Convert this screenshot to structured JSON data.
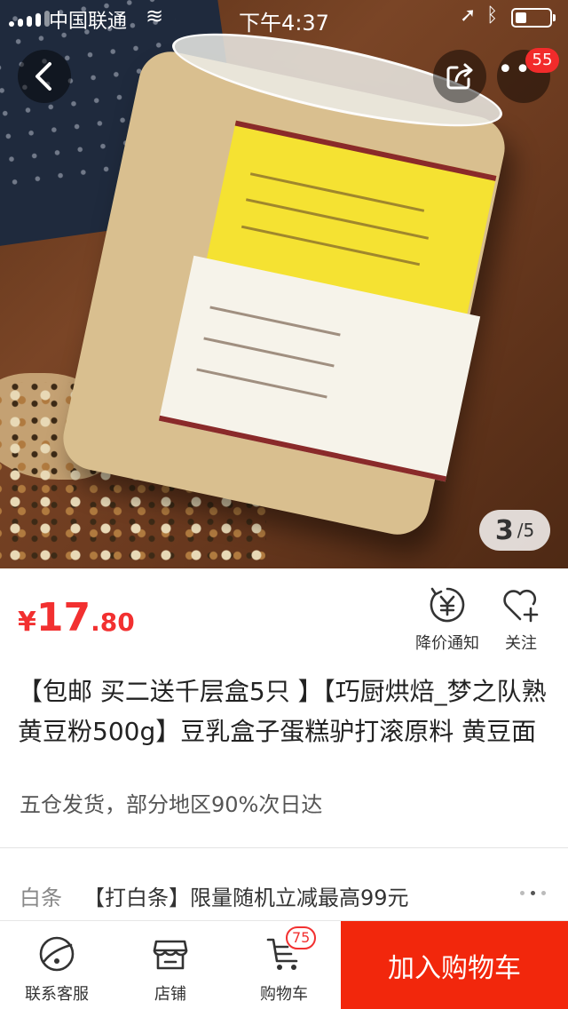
{
  "status_bar": {
    "carrier": "中国联通",
    "time": "下午4:37"
  },
  "gallery": {
    "current": "3",
    "total": "/5",
    "more_badge": "55"
  },
  "price": {
    "symbol": "¥",
    "integer": "17",
    "decimal": ".80"
  },
  "actions": {
    "notify_label": "降价通知",
    "follow_label": "关注"
  },
  "product": {
    "title": "【包邮 买二送千层盒5只 】【巧厨烘焙_梦之队熟黄豆粉500g】豆乳盒子蛋糕驴打滚原料 黄豆面",
    "subtitle": "五仓发货，部分地区90%次日达"
  },
  "credit": {
    "label": "白条",
    "promo": "【打白条】限量随机立减最高99元"
  },
  "bottom_bar": {
    "service_label": "联系客服",
    "shop_label": "店铺",
    "cart_label": "购物车",
    "cart_badge": "75",
    "add_to_cart": "加入购物车"
  },
  "colors": {
    "accent_red": "#f23030",
    "add_cart_bg": "#f2270c"
  },
  "icons": [
    "back-icon",
    "share-icon",
    "more-icon",
    "yen-bell-icon",
    "heart-plus-icon",
    "service-icon",
    "shop-icon",
    "cart-icon"
  ]
}
